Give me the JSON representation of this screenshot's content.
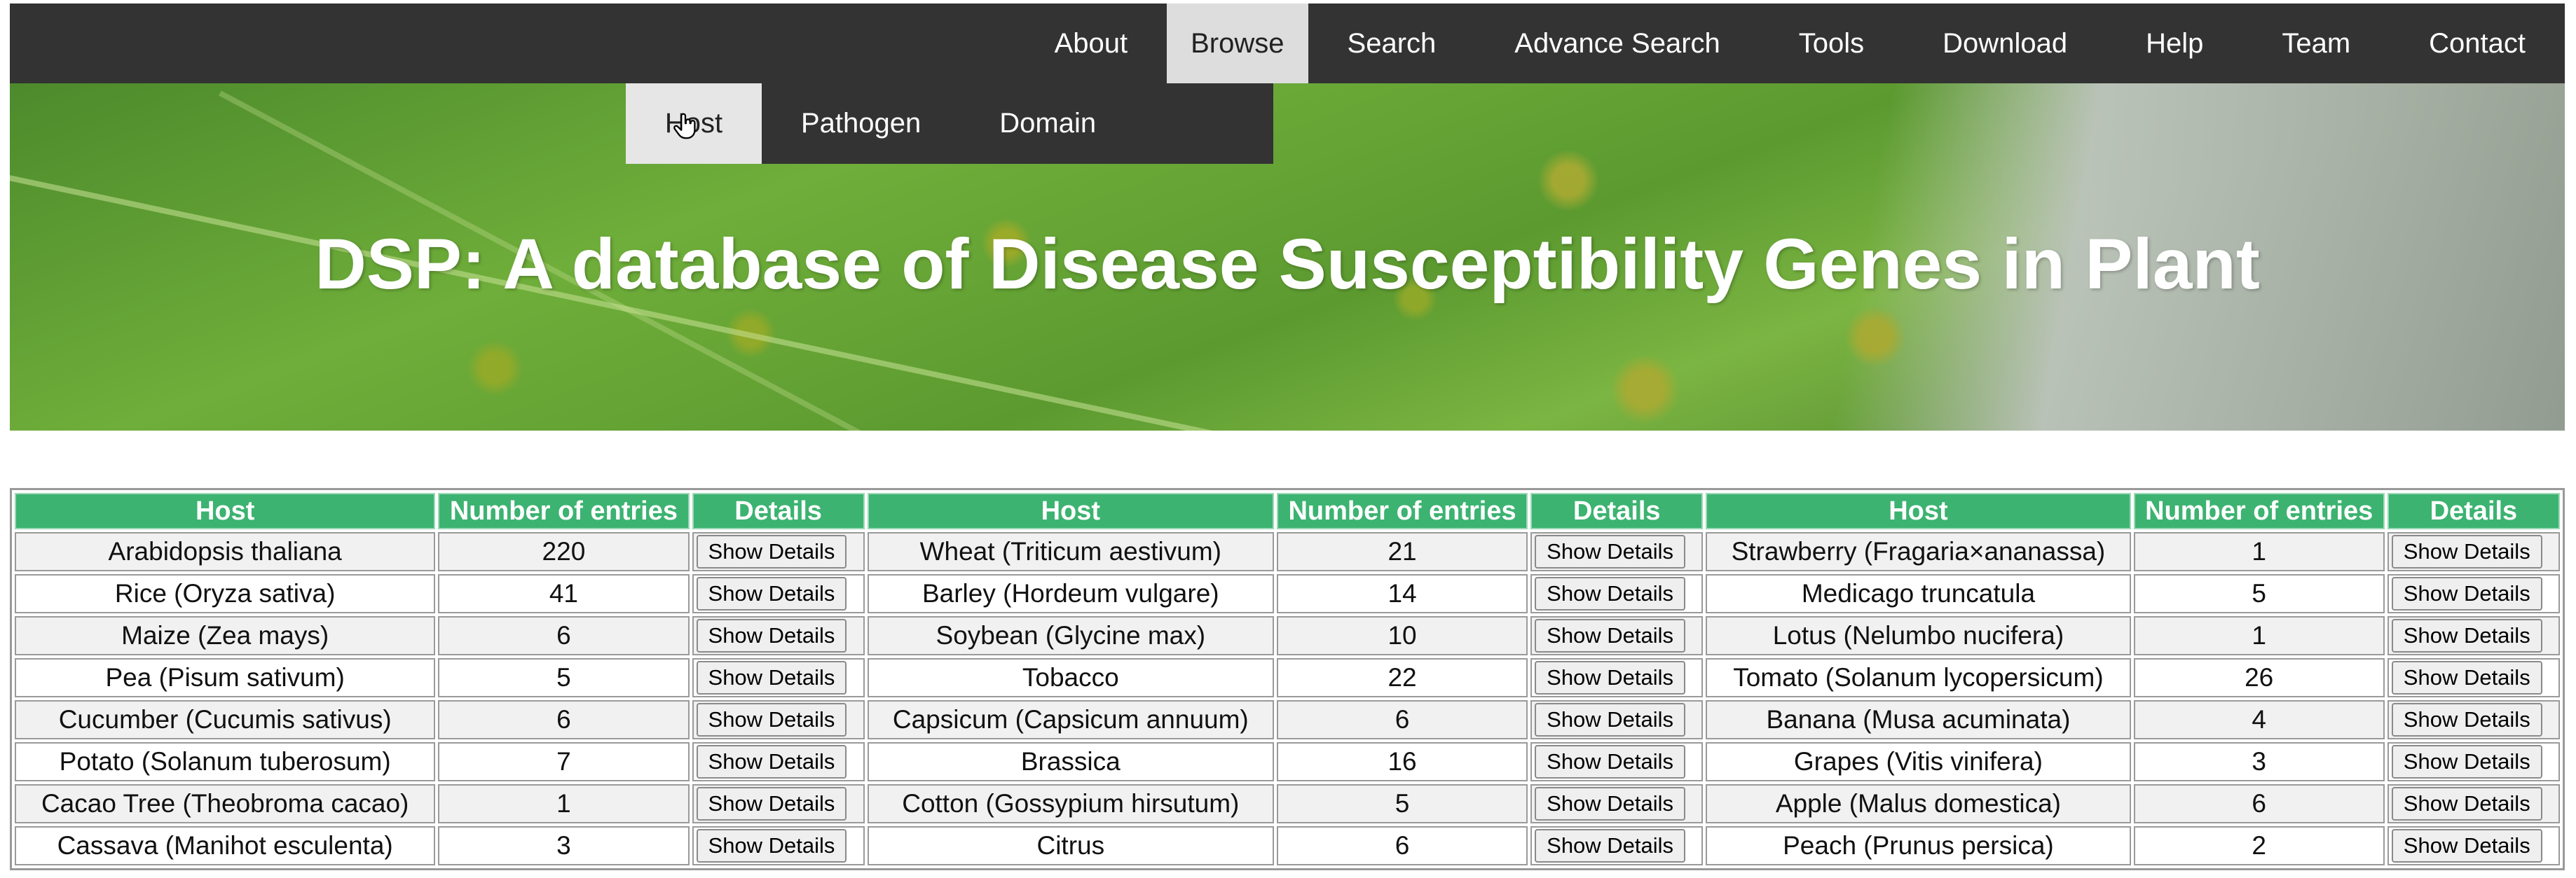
{
  "nav": {
    "items": [
      {
        "label": "About",
        "active": false
      },
      {
        "label": "Browse",
        "active": true
      },
      {
        "label": "Search",
        "active": false
      },
      {
        "label": "Advance Search",
        "active": false
      },
      {
        "label": "Tools",
        "active": false
      },
      {
        "label": "Download",
        "active": false
      },
      {
        "label": "Help",
        "active": false
      },
      {
        "label": "Team",
        "active": false
      },
      {
        "label": "Contact",
        "active": false
      }
    ]
  },
  "dropdown": {
    "items": [
      {
        "label": "Host",
        "hovered": true
      },
      {
        "label": "Pathogen",
        "hovered": false
      },
      {
        "label": "Domain",
        "hovered": false
      }
    ]
  },
  "hero": {
    "title": "DSP: A database of Disease Susceptibility Genes in Plant"
  },
  "table": {
    "headers": {
      "host": "Host",
      "entries": "Number of entries",
      "details": "Details"
    },
    "button_label": "Show Details",
    "rows": [
      [
        [
          "Arabidopsis thaliana",
          "220"
        ],
        [
          "Wheat (Triticum aestivum)",
          "21"
        ],
        [
          "Strawberry (Fragaria×ananassa)",
          "1"
        ]
      ],
      [
        [
          "Rice (Oryza sativa)",
          "41"
        ],
        [
          "Barley (Hordeum vulgare)",
          "14"
        ],
        [
          "Medicago truncatula",
          "5"
        ]
      ],
      [
        [
          "Maize (Zea mays)",
          "6"
        ],
        [
          "Soybean (Glycine max)",
          "10"
        ],
        [
          "Lotus (Nelumbo nucifera)",
          "1"
        ]
      ],
      [
        [
          "Pea (Pisum sativum)",
          "5"
        ],
        [
          "Tobacco",
          "22"
        ],
        [
          "Tomato (Solanum lycopersicum)",
          "26"
        ]
      ],
      [
        [
          "Cucumber (Cucumis sativus)",
          "6"
        ],
        [
          "Capsicum (Capsicum annuum)",
          "6"
        ],
        [
          "Banana (Musa acuminata)",
          "4"
        ]
      ],
      [
        [
          "Potato (Solanum tuberosum)",
          "7"
        ],
        [
          "Brassica",
          "16"
        ],
        [
          "Grapes (Vitis vinifera)",
          "3"
        ]
      ],
      [
        [
          "Cacao Tree (Theobroma cacao)",
          "1"
        ],
        [
          "Cotton (Gossypium hirsutum)",
          "5"
        ],
        [
          "Apple (Malus domestica)",
          "6"
        ]
      ],
      [
        [
          "Cassava (Manihot esculenta)",
          "3"
        ],
        [
          "Citrus",
          "6"
        ],
        [
          "Peach (Prunus persica)",
          "2"
        ]
      ]
    ]
  },
  "colors": {
    "nav_bg": "#333333",
    "nav_active_bg": "#dddddd",
    "header_green": "#3cb371"
  },
  "icons": {
    "cursor": "hand-pointer-icon"
  }
}
